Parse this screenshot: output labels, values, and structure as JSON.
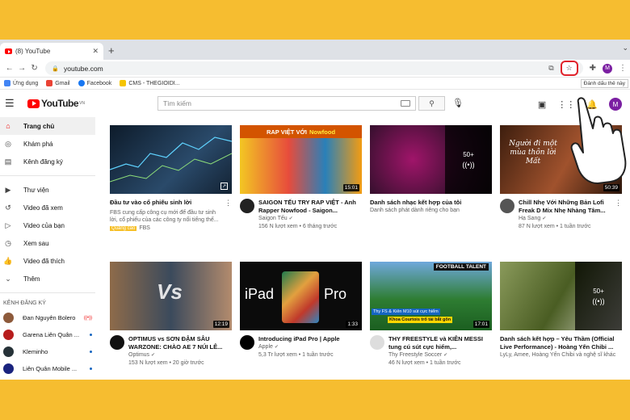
{
  "browser": {
    "tab_title": "(8) YouTube",
    "tab_close": "✕",
    "new_tab": "+",
    "url": "youtube.com",
    "bookmark_tooltip": "Đánh dấu thẻ này",
    "profile_initial": "M"
  },
  "bookmarks": [
    {
      "label": "Ứng dụng",
      "color": "#4285f4"
    },
    {
      "label": "Gmail",
      "color": "#ea4335"
    },
    {
      "label": "Facebook",
      "color": "#1877f2"
    },
    {
      "label": "CMS - THEGIOIDI...",
      "color": "#f5c400"
    }
  ],
  "youtube": {
    "logo_text": "YouTube",
    "logo_region": "VN",
    "search_placeholder": "Tìm kiếm",
    "avatar_initial": "M"
  },
  "sidebar": {
    "main": [
      {
        "label": "Trang chủ",
        "icon": "home-icon",
        "active": true
      },
      {
        "label": "Khám phá",
        "icon": "compass-icon"
      },
      {
        "label": "Kênh đăng ký",
        "icon": "subscriptions-icon"
      }
    ],
    "library": [
      {
        "label": "Thư viện",
        "icon": "library-icon"
      },
      {
        "label": "Video đã xem",
        "icon": "history-icon"
      },
      {
        "label": "Video của bạn",
        "icon": "your-videos-icon"
      },
      {
        "label": "Xem sau",
        "icon": "watch-later-icon"
      },
      {
        "label": "Video đã thích",
        "icon": "like-icon"
      },
      {
        "label": "Thêm",
        "icon": "chevron-down-icon"
      }
    ],
    "section_title": "KÊNH ĐĂNG KÝ",
    "subscriptions": [
      {
        "label": "Đan Nguyên Bolero",
        "color": "#8d5a3b",
        "indicator": "live"
      },
      {
        "label": "Garena Liên Quân ...",
        "color": "#b71c1c",
        "indicator": "dot"
      },
      {
        "label": "Kleminho",
        "color": "#263238",
        "indicator": "dot"
      },
      {
        "label": "Liên Quân Mobile ...",
        "color": "#1a237e",
        "indicator": "dot"
      }
    ]
  },
  "videos": [
    {
      "title": "Đầu tư vào cổ phiếu sinh lời",
      "ad": true,
      "desc": "FBS cung cấp công cụ mới để đầu tư sinh lời, cổ phiếu của các công ty nổi tiếng thế...",
      "ad_label": "Quảng cáo",
      "channel": "FBS",
      "thumb": "#1c2b3a"
    },
    {
      "title": "SAIGON TẾU TRY RAP VIỆT - Anh Rapper Nowfood - Saigon...",
      "channel": "Saigon Tếu",
      "stats": "156 N lượt xem • 6 tháng trước",
      "duration": "15:01",
      "thumb": "#c0392b",
      "av": "#222"
    },
    {
      "title": "Danh sách nhạc kết hợp của tôi",
      "channel": "Danh sách phát dành riêng cho bạn",
      "playlist": "50+",
      "thumb": "#3a1030"
    },
    {
      "title": "Chill Nhẹ Với Những Bản Lofi Freak D Mix Nhẹ Nhàng Tâm...",
      "channel": "Hạ Sang",
      "stats": "87 N lượt xem • 1 tuần trước",
      "duration": "50:39",
      "thumb": "#6b3a1f",
      "av": "#555"
    },
    {
      "title": "OPTIMUS vs SƠN ĐẬM SÂU WARZONE: CHÀO AE 7 NÚI LÊ...",
      "channel": "Optimus",
      "stats": "153 N lượt xem • 20 giờ trước",
      "duration": "12:19",
      "thumb": "#2c3e50",
      "av": "#111"
    },
    {
      "title": "Introducing iPad Pro | Apple",
      "channel": "Apple",
      "stats": "5,3 Tr lượt xem • 1 tuần trước",
      "duration": "1:33",
      "thumb": "#111111",
      "av": "#000"
    },
    {
      "title": "THY FREESTYLE và KIÊN MESSI tung cú sút cực hiểm,...",
      "channel": "Thy Freestyle Soccer",
      "stats": "46 N lượt xem • 1 tuần trước",
      "duration": "17:01",
      "thumb": "#2e7d32",
      "av": "#eee"
    },
    {
      "title": "Danh sách kết hợp – Yêu Thầm (Official Live Performance) - Hoàng Yến Chibi ...",
      "channel": "LyLy, Amee, Hoàng Yến Chibi và nghệ sĩ khác",
      "playlist": "50+",
      "thumb": "#556b2f"
    }
  ],
  "thumb_text": {
    "rap_title": "RAP VIỆT VỚI",
    "rap_brand": "Nowfood",
    "lofi_text": "Người đi một mùa thôn lời Mất",
    "ipad_left": "iPad",
    "ipad_right": "Pro",
    "football_banner": "FOOTBALL TALENT",
    "football_caption": "Thy FS & Kiên M10 sút cực hiểm",
    "football_caption2": "Khoa Courtois trổ tài bắt gôn",
    "vs_text": "Vs"
  },
  "colors": {
    "background": "#f6bd30",
    "youtube_red": "#ff0000",
    "highlight_ring": "#e0232b"
  }
}
